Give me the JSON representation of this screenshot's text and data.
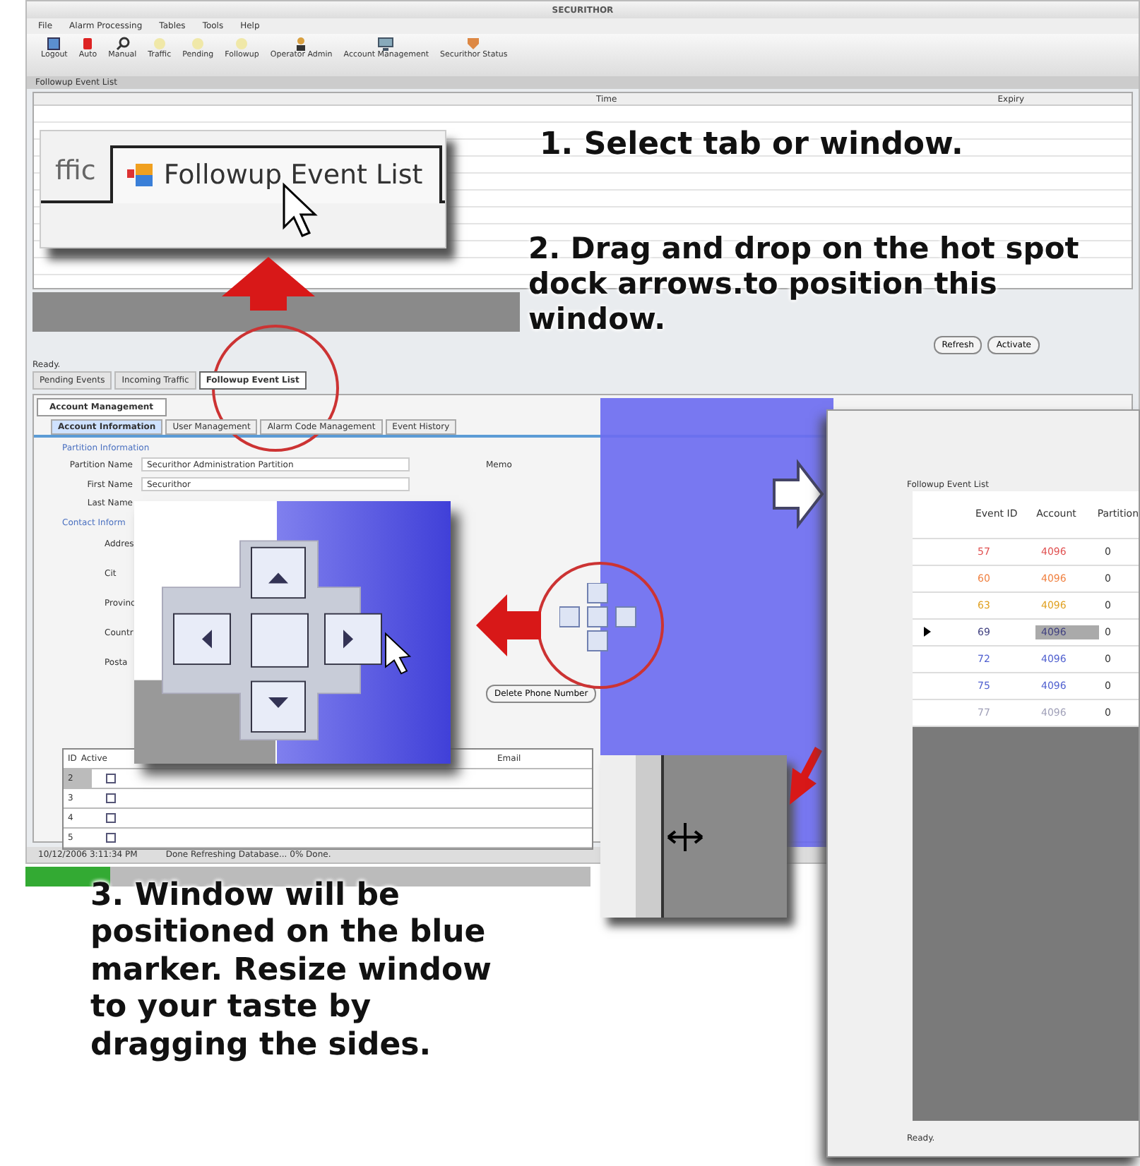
{
  "app_window": {
    "title": "SECURITHOR",
    "menu": [
      "File",
      "Alarm Processing",
      "Tables",
      "Tools",
      "Help"
    ],
    "toolbar": [
      {
        "label": "Logout",
        "kind": "doc"
      },
      {
        "label": "Auto",
        "kind": "alarm"
      },
      {
        "label": "Manual",
        "kind": "search"
      },
      {
        "label": "Traffic",
        "kind": "light"
      },
      {
        "label": "Pending",
        "kind": "light"
      },
      {
        "label": "Followup",
        "kind": "light"
      },
      {
        "label": "Operator Admin",
        "kind": "user"
      },
      {
        "label": "Account Management",
        "kind": "monitor"
      },
      {
        "label": "Securithor Status",
        "kind": "shield"
      }
    ],
    "pane_title": "Followup Event List",
    "table_columns": [
      "Time",
      "Expiry"
    ],
    "status": "Ready.",
    "buttons": [
      "Refresh",
      "Activate"
    ],
    "doc_tabs": [
      {
        "label": "Pending Events",
        "selected": false
      },
      {
        "label": "Incoming Traffic",
        "selected": false
      },
      {
        "label": "Followup Event List",
        "selected": true
      }
    ]
  },
  "account_window": {
    "tab": "Account Management",
    "subtabs": [
      {
        "label": "Account Information",
        "selected": true
      },
      {
        "label": "User Management",
        "selected": false
      },
      {
        "label": "Alarm Code Management",
        "selected": false
      },
      {
        "label": "Event History",
        "selected": false
      }
    ],
    "partition_section": "Partition Information",
    "fields": [
      {
        "label": "Partition Name",
        "value": "Securithor Administration Partition"
      },
      {
        "label": "First Name",
        "value": "Securithor"
      },
      {
        "label": "Last Name"
      }
    ],
    "memo_label": "Memo",
    "contact_section": "Contact Inform",
    "contact_labels": [
      "Addres",
      "Cit",
      "Provinc",
      "Countr",
      "Posta"
    ],
    "delete_button": "Delete Phone Number",
    "grid_columns": [
      "ID",
      "Active",
      "Email"
    ],
    "grid_rows": [
      {
        "id": "2",
        "checked": false,
        "selected": true
      },
      {
        "id": "3",
        "checked": false,
        "selected": false
      },
      {
        "id": "4",
        "checked": false,
        "selected": false
      },
      {
        "id": "5",
        "checked": false,
        "selected": false
      }
    ],
    "status_time": "10/12/2006 3:11:34 PM",
    "status_text": "Done Refreshing Database... 0% Done."
  },
  "tab_zoom": {
    "partial_tab": "ffic",
    "tab": "Followup Event List"
  },
  "steps": [
    "1. Select tab or window.",
    "2. Drag and drop on the hot spot dock arrows.to position this window.",
    "3. Window will be positioned on the blue marker. Resize window to your taste by dragging the sides."
  ],
  "followup_panel": {
    "title": "Followup Event List",
    "columns": [
      "Event ID",
      "Account",
      "Partition"
    ],
    "rows": [
      {
        "event_id": "57",
        "account": "4096",
        "partition": "0",
        "color": "#e05050",
        "selected": false
      },
      {
        "event_id": "60",
        "account": "4096",
        "partition": "0",
        "color": "#f08040",
        "selected": false
      },
      {
        "event_id": "63",
        "account": "4096",
        "partition": "0",
        "color": "#e0a020",
        "selected": false
      },
      {
        "event_id": "69",
        "account": "4096",
        "partition": "0",
        "color": "#404080",
        "selected": true
      },
      {
        "event_id": "72",
        "account": "4096",
        "partition": "0",
        "color": "#5060d0",
        "selected": false
      },
      {
        "event_id": "75",
        "account": "4096",
        "partition": "0",
        "color": "#5060d0",
        "selected": false
      },
      {
        "event_id": "77",
        "account": "4096",
        "partition": "0",
        "color": "#a0a0b8",
        "selected": false
      }
    ],
    "status": "Ready."
  }
}
